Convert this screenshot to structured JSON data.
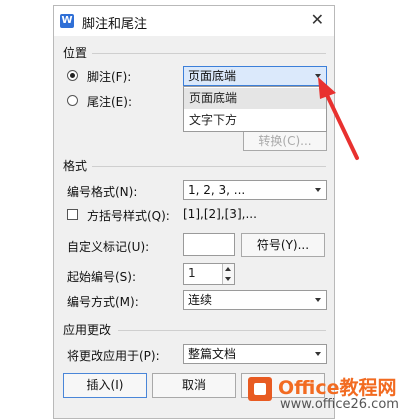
{
  "dialog": {
    "title": "脚注和尾注",
    "app_icon": "W",
    "close_glyph": "✕"
  },
  "position": {
    "title": "位置",
    "footnote_label": "脚注(F):",
    "endnote_label": "尾注(E):",
    "footnote_checked": true,
    "footnote_value": "页面底端",
    "options": [
      "页面底端",
      "文字下方"
    ],
    "convert_label": "转换(C)..."
  },
  "format": {
    "title": "格式",
    "numbering_label": "编号格式(N):",
    "numbering_value": "1, 2, 3, ...",
    "bracket_label": "方括号样式(Q):",
    "bracket_value": "[1],[2],[3],...",
    "custom_label": "自定义标记(U):",
    "custom_value": "",
    "symbol_button": "符号(Y)...",
    "start_label": "起始编号(S):",
    "start_value": "1",
    "mode_label": "编号方式(M):",
    "mode_value": "连续"
  },
  "apply": {
    "title": "应用更改",
    "apply_label": "将更改应用于(P):",
    "apply_value": "整篇文档"
  },
  "buttons": {
    "insert": "插入(I)",
    "cancel": "取消"
  },
  "watermark": {
    "line1": "Office教程网",
    "line2": "www.office26.com"
  },
  "colors": {
    "accent": "#3c7fd9",
    "arrow": "#e8312f",
    "watermark": "#f26b21"
  }
}
